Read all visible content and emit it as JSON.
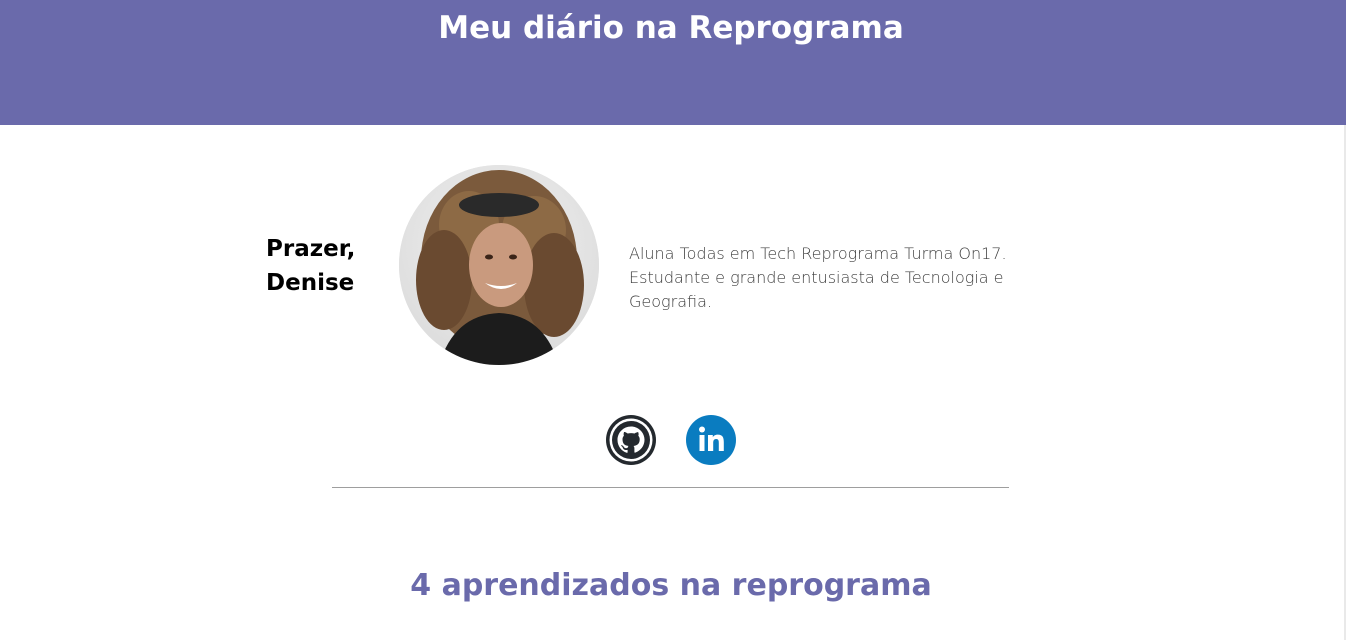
{
  "header": {
    "title": "Meu diário na Reprograma",
    "background_color": "#6a6aab"
  },
  "profile": {
    "greeting_line1": "Prazer,",
    "greeting_line2": "Denise",
    "photo_alt": "Foto de perfil",
    "bio": "Aluna Todas em Tech Reprograma Turma On17. Estudante e grande entusiasta de Tecnologia e Geografia."
  },
  "social_links": [
    {
      "icon": "github-icon",
      "color": "#24292e"
    },
    {
      "icon": "linkedin-icon",
      "color": "#0a7cc0"
    }
  ],
  "section": {
    "title": "4 aprendizados na reprograma",
    "color": "#6a6aab"
  }
}
